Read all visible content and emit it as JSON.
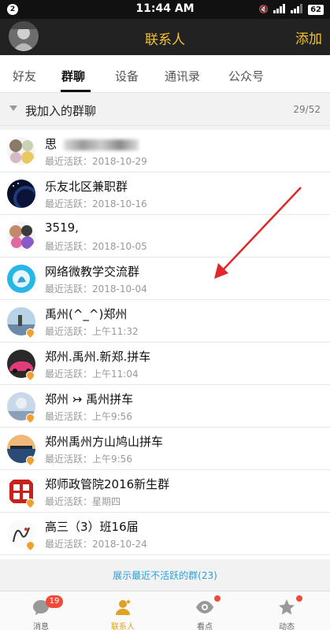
{
  "status_bar": {
    "notification_count": "2",
    "time": "11:44 AM",
    "battery": "62"
  },
  "header": {
    "title": "联系人",
    "add_label": "添加"
  },
  "tabs": [
    {
      "label": "好友",
      "active": false
    },
    {
      "label": "群聊",
      "active": true
    },
    {
      "label": "设备",
      "active": false
    },
    {
      "label": "通讯录",
      "active": false
    },
    {
      "label": "公众号",
      "active": false
    }
  ],
  "section": {
    "title": "我加入的群聊",
    "count": "29/52"
  },
  "groups": [
    {
      "name": "思",
      "sub": "最近活跃：2018-10-29",
      "avatar": "multi-avatar",
      "flame": false
    },
    {
      "name": "乐友北区兼职群",
      "sub": "最近活跃：2018-10-16",
      "avatar": "planet-avatar",
      "flame": false
    },
    {
      "name": "3519,",
      "sub": "最近活跃：2018-10-05",
      "avatar": "multi-avatar",
      "flame": false
    },
    {
      "name": "网络微教学交流群",
      "sub": "最近活跃：2018-10-04",
      "avatar": "cyan-avatar",
      "flame": false
    },
    {
      "name": "禹州(^_^)郑州",
      "sub": "最近活跃：上午11:32",
      "avatar": "landscape-avatar",
      "flame": true
    },
    {
      "name": "郑州.禹州.新郑.拼车",
      "sub": "最近活跃：上午11:04",
      "avatar": "car-avatar",
      "flame": true
    },
    {
      "name": "郑州 ↣ 禹州拼车",
      "sub": "最近活跃：上午9:56",
      "avatar": "landscape-avatar",
      "flame": true
    },
    {
      "name": "郑州禹州方山鸠山拼车",
      "sub": "最近活跃：上午9:56",
      "avatar": "lake-avatar",
      "flame": true
    },
    {
      "name": "郑师政管院2016新生群",
      "sub": "最近活跃：星期四",
      "avatar": "seal-avatar",
      "flame": true
    },
    {
      "name": "高三（3）班16届",
      "sub": "最近活跃：2018-10-24",
      "avatar": "drawing-avatar",
      "flame": true
    }
  ],
  "show_inactive_label": "展示最近不活跃的群(23)",
  "bottom_nav": [
    {
      "label": "消息",
      "icon": "chat-bubble-icon",
      "badge": "19"
    },
    {
      "label": "联系人",
      "icon": "contacts-person-icon",
      "active": true
    },
    {
      "label": "看点",
      "icon": "eye-icon",
      "dot": true
    },
    {
      "label": "动态",
      "icon": "star-icon",
      "dot": true
    }
  ],
  "colors": {
    "accent": "#f2c230",
    "link": "#2a9fd8",
    "badge": "#f04b3a",
    "annotation": "#e0282a"
  }
}
